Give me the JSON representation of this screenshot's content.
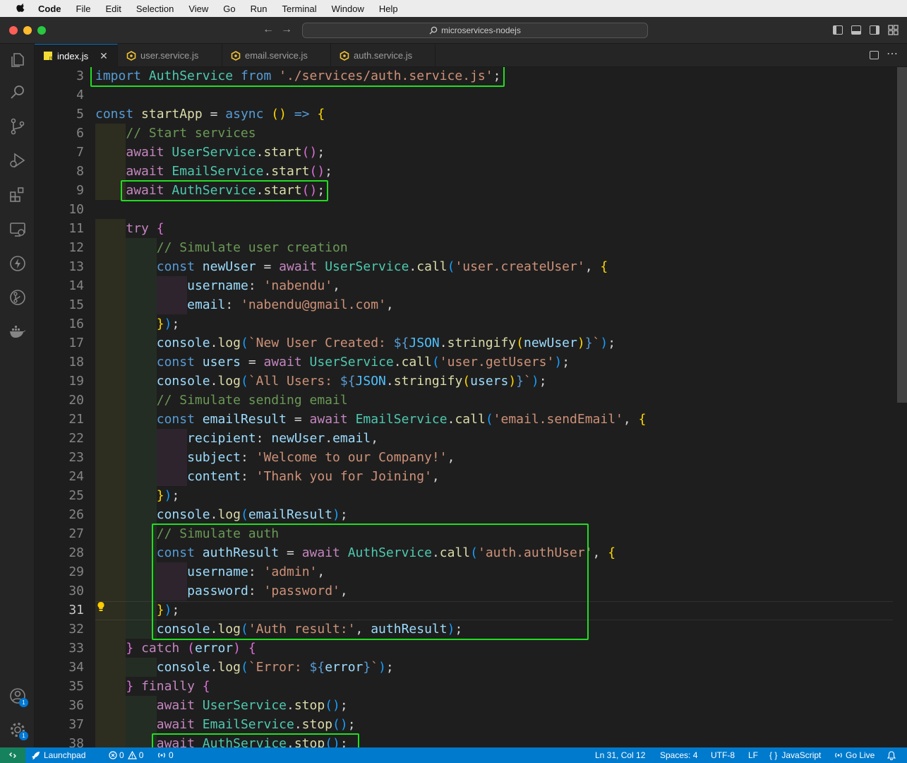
{
  "menubar": {
    "app": "Code",
    "items": [
      "File",
      "Edit",
      "Selection",
      "View",
      "Go",
      "Run",
      "Terminal",
      "Window",
      "Help"
    ]
  },
  "titlebar": {
    "search_text": "microservices-nodejs"
  },
  "tabs": [
    {
      "label": "index.js",
      "active": true,
      "icon": "js-file-icon"
    },
    {
      "label": "user.service.js",
      "active": false,
      "icon": "node-file-icon"
    },
    {
      "label": "email.service.js",
      "active": false,
      "icon": "node-file-icon"
    },
    {
      "label": "auth.service.js",
      "active": false,
      "icon": "node-file-icon"
    }
  ],
  "editor": {
    "current_line": 31,
    "line_numbers": [
      "3",
      "4",
      "5",
      "6",
      "7",
      "8",
      "9",
      "10",
      "11",
      "12",
      "13",
      "14",
      "15",
      "16",
      "17",
      "18",
      "19",
      "20",
      "21",
      "22",
      "23",
      "24",
      "25",
      "26",
      "27",
      "28",
      "29",
      "30",
      "31",
      "32",
      "33",
      "34",
      "35",
      "36",
      "37",
      "38"
    ],
    "lines": [
      "import AuthService from './services/auth.service.js';",
      "",
      "const startApp = async () => {",
      "    // Start services",
      "    await UserService.start();",
      "    await EmailService.start();",
      "    await AuthService.start();",
      "",
      "    try {",
      "        // Simulate user creation",
      "        const newUser = await UserService.call('user.createUser', {",
      "            username: 'nabendu',",
      "            email: 'nabendu@gmail.com',",
      "        });",
      "        console.log(`New User Created: ${JSON.stringify(newUser)}`);",
      "        const users = await UserService.call('user.getUsers');",
      "        console.log(`All Users: ${JSON.stringify(users)}`);",
      "        // Simulate sending email",
      "        const emailResult = await EmailService.call('email.sendEmail', {",
      "            recipient: newUser.email,",
      "            subject: 'Welcome to our Company!',",
      "            content: 'Thank you for Joining',",
      "        });",
      "        console.log(emailResult);",
      "        // Simulate auth",
      "        const authResult = await AuthService.call('auth.authUser', {",
      "            username: 'admin',",
      "            password: 'password',",
      "        });",
      "        console.log('Auth result:', authResult);",
      "    } catch (error) {",
      "        console.log(`Error: ${error}`);",
      "    } finally {",
      "        await UserService.stop();",
      "        await EmailService.stop();",
      "        await AuthService.stop();"
    ]
  },
  "statusbar": {
    "launchpad": "Launchpad",
    "errors": "0",
    "warnings": "0",
    "ports": "0",
    "cursor": "Ln 31, Col 12",
    "spaces": "Spaces: 4",
    "encoding": "UTF-8",
    "eol": "LF",
    "language": "JavaScript",
    "golive": "Go Live"
  },
  "activity_badges": {
    "accounts": "1",
    "manage": "1"
  },
  "colors": {
    "highlight": "#22dd22",
    "statusbar": "#007acc",
    "accent": "#0078d4"
  }
}
